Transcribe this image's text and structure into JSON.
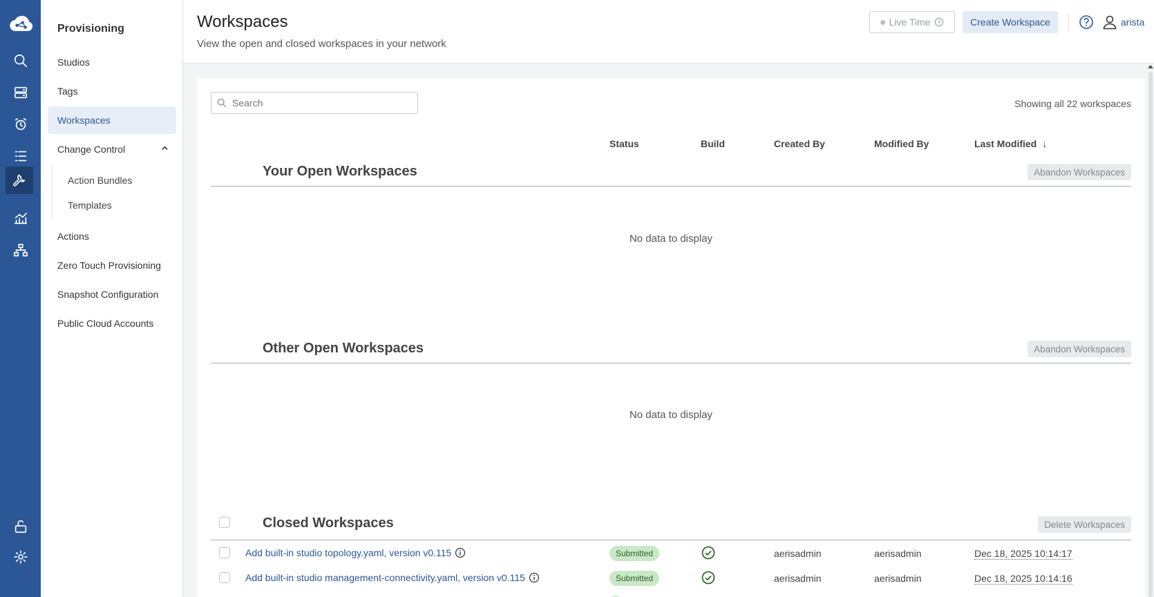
{
  "rail": {
    "icons": [
      "cloud-logo-icon",
      "search-icon",
      "devices-icon",
      "alarm-clock-icon",
      "list-icon",
      "wrench-icon",
      "analytics-icon",
      "topology-icon",
      "unlock-icon",
      "gear-icon"
    ],
    "active": "wrench-icon"
  },
  "nav": {
    "title": "Provisioning",
    "items": {
      "studios": "Studios",
      "tags": "Tags",
      "workspaces": "Workspaces",
      "change_control": "Change Control",
      "action_bundles": "Action Bundles",
      "templates": "Templates",
      "actions": "Actions",
      "ztp": "Zero Touch Provisioning",
      "snapshot": "Snapshot Configuration",
      "public_cloud": "Public Cloud Accounts"
    }
  },
  "header": {
    "title": "Workspaces",
    "subtitle": "View the open and closed workspaces in your network",
    "live_time": "Live Time",
    "create_button": "Create Workspace",
    "username": "arista"
  },
  "search": {
    "placeholder": "Search"
  },
  "showing": "Showing all 22 workspaces",
  "columns": {
    "status": "Status",
    "build": "Build",
    "created_by": "Created By",
    "modified_by": "Modified By",
    "last_modified": "Last Modified"
  },
  "sections": {
    "your_open": {
      "title": "Your Open Workspaces",
      "button": "Abandon Workspaces",
      "empty": "No data to display"
    },
    "other_open": {
      "title": "Other Open Workspaces",
      "button": "Abandon Workspaces",
      "empty": "No data to display"
    },
    "closed": {
      "title": "Closed Workspaces",
      "button": "Delete Workspaces"
    }
  },
  "closed_rows": [
    {
      "title": "Add built-in studio topology.yaml, version v0.115",
      "status": "Submitted",
      "created_by": "aerisadmin",
      "modified_by": "aerisadmin",
      "last_modified": "Dec 18, 2025 10:14:17"
    },
    {
      "title": "Add built-in studio management-connectivity.yaml, version v0.115",
      "status": "Submitted",
      "created_by": "aerisadmin",
      "modified_by": "aerisadmin",
      "last_modified": "Dec 18, 2025 10:14:16"
    }
  ],
  "colors": {
    "rail": "#2b5797",
    "link": "#2b5797",
    "badge_bg": "#c9e8c6"
  }
}
